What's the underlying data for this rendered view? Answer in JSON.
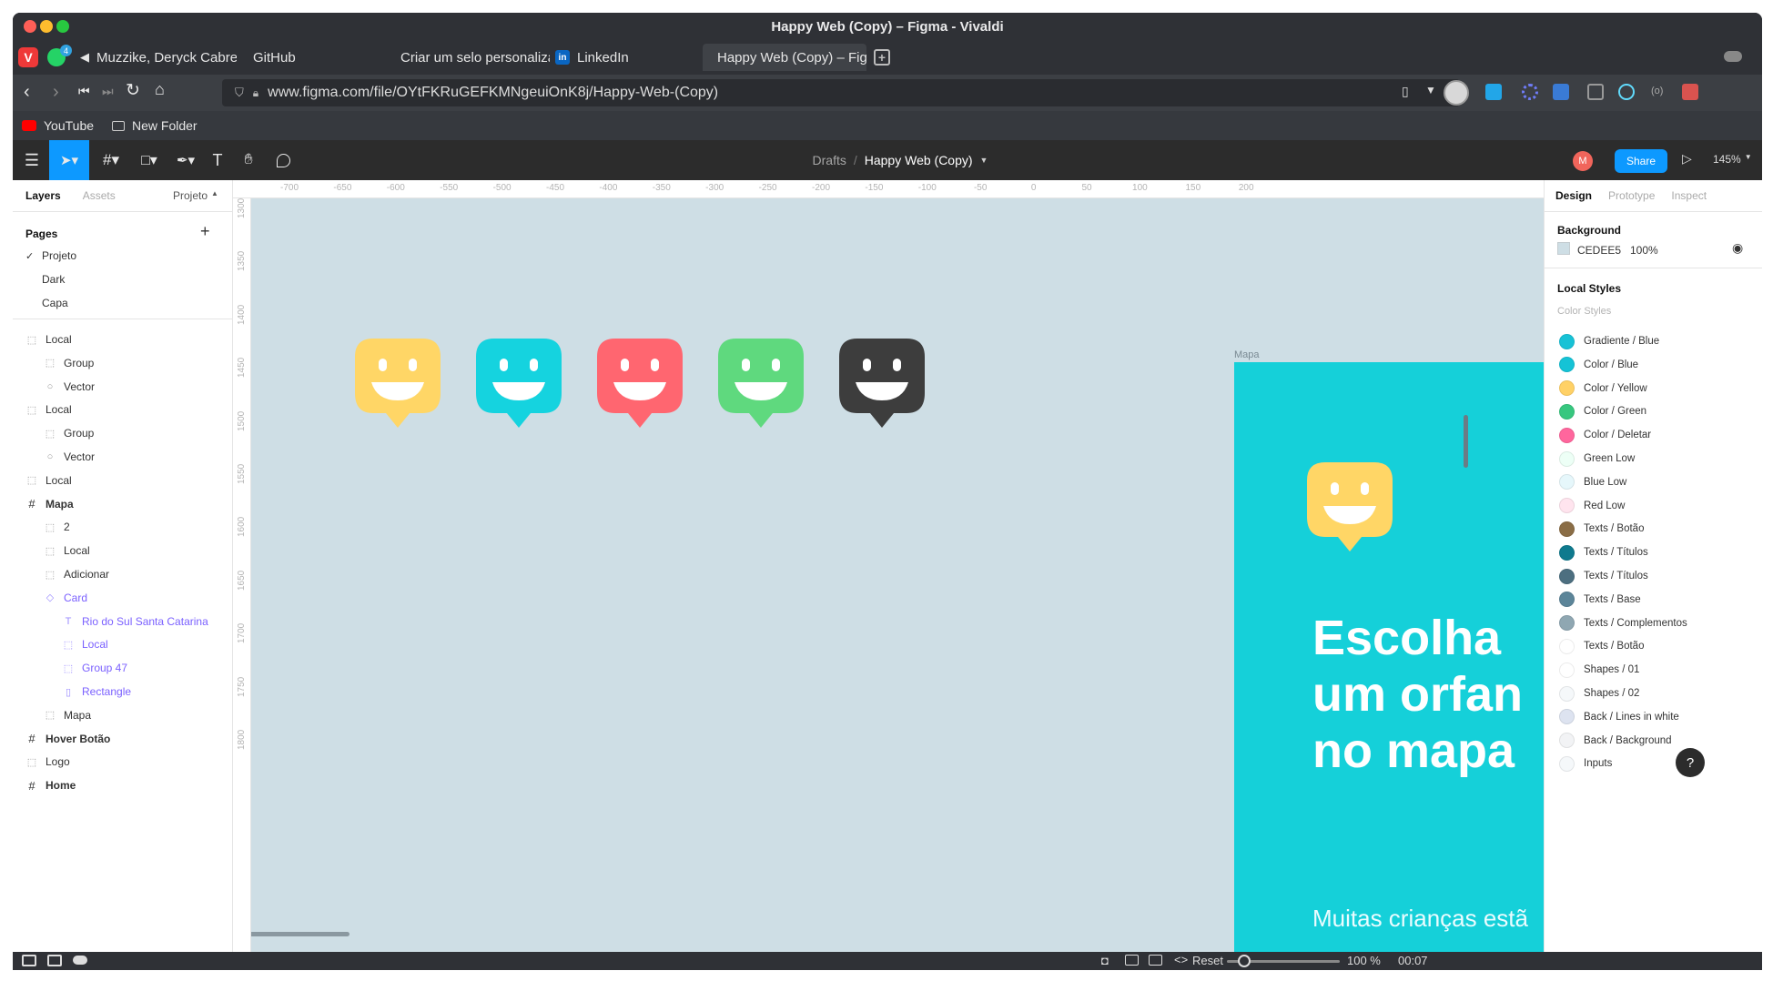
{
  "window": {
    "title": "Happy Web (Copy) – Figma - Vivaldi"
  },
  "tabs": [
    {
      "label": "Muzzike, Deryck Cabrera \"",
      "icon": "speaker-icon"
    },
    {
      "label": "GitHub",
      "icon": ""
    },
    {
      "label": "Criar um selo personalizad",
      "icon": "github-icon"
    },
    {
      "label": "LinkedIn",
      "icon": "linkedin-icon"
    },
    {
      "label": "Happy Web (Copy) – Figma",
      "icon": "figma-icon"
    }
  ],
  "notif_count": "4",
  "address": {
    "url": "www.figma.com/file/OYtFKRuGEFKMNgeuiOnK8j/Happy-Web-(Copy)"
  },
  "bookmarks": [
    {
      "label": "YouTube"
    },
    {
      "label": "New Folder"
    }
  ],
  "figma": {
    "breadcrumb_drafts": "Drafts",
    "breadcrumb_sep": "/",
    "file_name": "Happy Web (Copy)",
    "avatar_initial": "M",
    "share_label": "Share",
    "zoom": "145%"
  },
  "left_panel": {
    "tab_layers": "Layers",
    "tab_assets": "Assets",
    "page_dropdown": "Projeto",
    "pages_title": "Pages",
    "pages": [
      {
        "name": "Projeto",
        "checked": true
      },
      {
        "name": "Dark",
        "checked": false
      },
      {
        "name": "Capa",
        "checked": false
      }
    ],
    "layers": [
      {
        "name": "Local",
        "indent": 0,
        "type": "group",
        "bold": false,
        "purple": false
      },
      {
        "name": "Group",
        "indent": 1,
        "type": "group",
        "bold": false,
        "purple": false
      },
      {
        "name": "Vector",
        "indent": 1,
        "type": "vector",
        "bold": false,
        "purple": false
      },
      {
        "name": "Local",
        "indent": 0,
        "type": "group",
        "bold": false,
        "purple": false
      },
      {
        "name": "Group",
        "indent": 1,
        "type": "group",
        "bold": false,
        "purple": false
      },
      {
        "name": "Vector",
        "indent": 1,
        "type": "vector",
        "bold": false,
        "purple": false
      },
      {
        "name": "Local",
        "indent": 0,
        "type": "group",
        "bold": false,
        "purple": false
      },
      {
        "name": "Mapa",
        "indent": 0,
        "type": "frame",
        "bold": true,
        "purple": false
      },
      {
        "name": "2",
        "indent": 1,
        "type": "group",
        "bold": false,
        "purple": false
      },
      {
        "name": "Local",
        "indent": 1,
        "type": "group",
        "bold": false,
        "purple": false
      },
      {
        "name": "Adicionar",
        "indent": 1,
        "type": "group",
        "bold": false,
        "purple": false
      },
      {
        "name": "Card",
        "indent": 1,
        "type": "component",
        "bold": false,
        "purple": true
      },
      {
        "name": "Rio do Sul Santa Catarina",
        "indent": 2,
        "type": "text",
        "bold": false,
        "purple": true
      },
      {
        "name": "Local",
        "indent": 2,
        "type": "group",
        "bold": false,
        "purple": true
      },
      {
        "name": "Group 47",
        "indent": 2,
        "type": "group",
        "bold": false,
        "purple": true
      },
      {
        "name": "Rectangle",
        "indent": 2,
        "type": "rect",
        "bold": false,
        "purple": true
      },
      {
        "name": "Mapa",
        "indent": 1,
        "type": "group",
        "bold": false,
        "purple": false
      },
      {
        "name": "Hover Botão",
        "indent": 0,
        "type": "frame",
        "bold": true,
        "purple": false
      },
      {
        "name": "Logo",
        "indent": 0,
        "type": "group",
        "bold": false,
        "purple": false
      },
      {
        "name": "Home",
        "indent": 0,
        "type": "frame",
        "bold": true,
        "purple": false
      }
    ]
  },
  "ruler_top": [
    "-700",
    "-650",
    "-600",
    "-550",
    "-500",
    "-450",
    "-400",
    "-350",
    "-300",
    "-250",
    "-200",
    "-150",
    "-100",
    "-50",
    "0",
    "50",
    "100",
    "150",
    "200"
  ],
  "ruler_left": [
    "1300",
    "1350",
    "1400",
    "1450",
    "1500",
    "1550",
    "1600",
    "1650",
    "1700",
    "1750",
    "1800"
  ],
  "canvas": {
    "smileys": [
      {
        "name": "yellow",
        "color": "#ffd666"
      },
      {
        "name": "blue",
        "color": "#15d3df"
      },
      {
        "name": "red",
        "color": "#ff6670"
      },
      {
        "name": "green",
        "color": "#5fd97e"
      },
      {
        "name": "dark",
        "color": "#3d3d3d"
      }
    ],
    "frame_label": "Mapa",
    "frame_bg": "#15d0d9",
    "headline": [
      "Escolha",
      "um orfan",
      "no mapa"
    ],
    "subtext": "Muitas crianças estã"
  },
  "right_panel": {
    "tab_design": "Design",
    "tab_prototype": "Prototype",
    "tab_inspect": "Inspect",
    "background_title": "Background",
    "bg_hex": "CEDEE5",
    "bg_opacity": "100%",
    "local_styles_title": "Local Styles",
    "color_styles_title": "Color Styles",
    "styles": [
      {
        "name": "Gradiente / Blue",
        "color": "#17c2d6"
      },
      {
        "name": "Color / Blue",
        "color": "#15c3d6"
      },
      {
        "name": "Color / Yellow",
        "color": "#ffd166"
      },
      {
        "name": "Color / Green",
        "color": "#37c77f"
      },
      {
        "name": "Color / Deletar",
        "color": "#ff669d"
      },
      {
        "name": "Green Low",
        "color": "#edfff6"
      },
      {
        "name": "Blue Low",
        "color": "#e6f7fb"
      },
      {
        "name": "Red Low",
        "color": "#ffe4ee"
      },
      {
        "name": "Texts / Botão",
        "color": "#8a6d46"
      },
      {
        "name": "Texts / Títulos",
        "color": "#0f7a8e"
      },
      {
        "name": "Texts / Títulos",
        "color": "#4d6f80"
      },
      {
        "name": "Texts / Base",
        "color": "#5c8599"
      },
      {
        "name": "Texts / Complementos",
        "color": "#8fa7b2"
      },
      {
        "name": "Texts / Botão",
        "color": "#ffffff"
      },
      {
        "name": "Shapes / 01",
        "color": "#ffffff"
      },
      {
        "name": "Shapes / 02",
        "color": "#f5f8fa"
      },
      {
        "name": "Back / Lines in white",
        "color": "#dde3f0"
      },
      {
        "name": "Back / Background",
        "color": "#f2f3f5"
      },
      {
        "name": "Inputs",
        "color": "#f5f8fa"
      }
    ],
    "help": "?"
  },
  "statusbar": {
    "reset_label": "Reset",
    "zoom": "100 %",
    "clock": "00:07"
  }
}
